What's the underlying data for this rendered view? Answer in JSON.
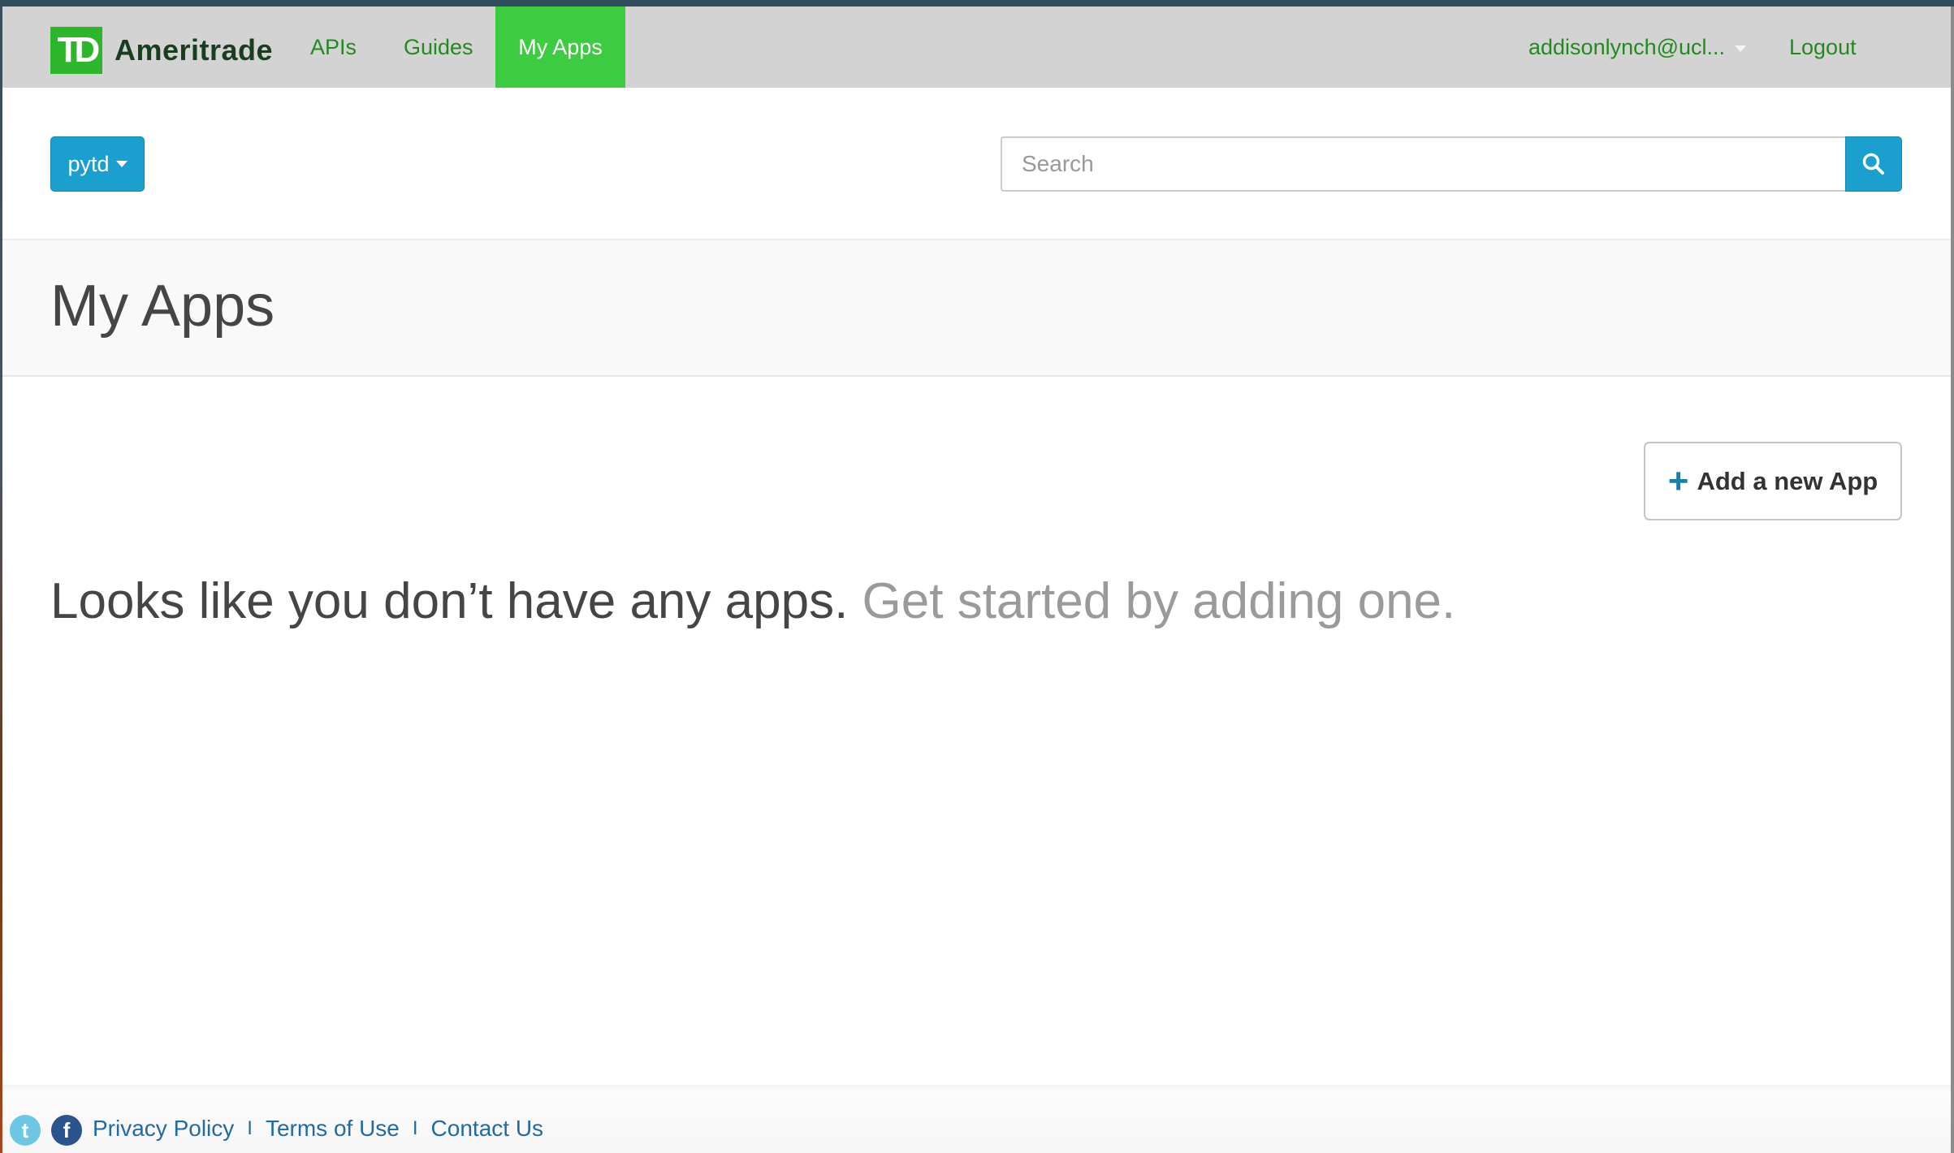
{
  "navbar": {
    "logo_mark": "TD",
    "logo_word": "Ameritrade",
    "links": [
      {
        "label": "APIs",
        "active": false
      },
      {
        "label": "Guides",
        "active": false
      },
      {
        "label": "My Apps",
        "active": true
      }
    ],
    "user_label": "addisonlynch@ucl...",
    "logout_label": "Logout"
  },
  "subbar": {
    "app_select_label": "pytd",
    "search": {
      "value": "",
      "placeholder": "Search"
    },
    "search_icon": "search-icon"
  },
  "page": {
    "title": "My Apps",
    "add_button_icon": "plus-icon",
    "add_button_label": "Add a new App",
    "empty_message": "Looks like you don’t have any apps.",
    "empty_cta": "Get started by adding one."
  },
  "footer": {
    "social": [
      {
        "name": "twitter-icon",
        "glyph": "t"
      },
      {
        "name": "facebook-icon",
        "glyph": "f"
      }
    ],
    "links": [
      "Privacy Policy",
      "Terms of Use",
      "Contact Us"
    ],
    "separator": "I"
  },
  "colors": {
    "brand_green": "#2db52b",
    "active_tab": "#3ccb41",
    "nav_link": "#238a20",
    "primary_blue": "#1b9fcf",
    "footer_link": "#236aa2"
  }
}
